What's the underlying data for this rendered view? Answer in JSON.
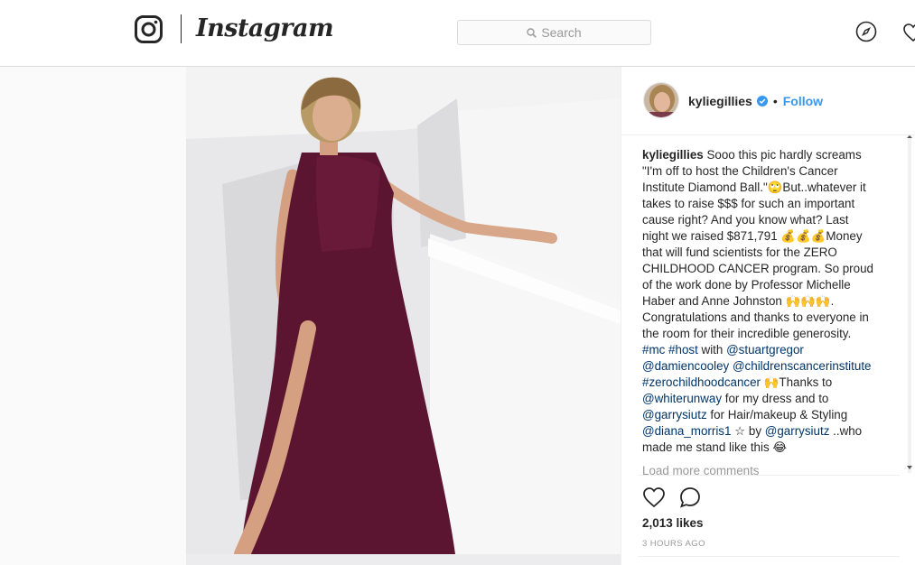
{
  "app": {
    "wordmark": "Instagram"
  },
  "search": {
    "placeholder": "Search"
  },
  "post": {
    "username": "kyliegillies",
    "verified": true,
    "follow_label": "Follow",
    "caption_lines": [
      "Sooo this pic hardly screams",
      "\"I'm off to host the Children's Cancer",
      "Institute Diamond Ball.\"🙄But..whatever it",
      "takes to raise $$$ for such an important",
      "cause right? And you know what? Last",
      "night we raised $871,791 💰💰💰Money",
      "that will fund scientists for the ZERO",
      "CHILDHOOD CANCER program. So proud",
      "of the work done by Professor Michelle",
      "Haber and Anne Johnston 🙌🙌🙌.",
      "Congratulations and thanks to everyone in",
      "the room for their incredible generosity."
    ],
    "line_13": {
      "tag1": "#mc",
      "tag2": "#host",
      "text": " with ",
      "mention": "@stuartgregor"
    },
    "line_14": {
      "mention1": "@damiencooley",
      "mention2": "@childrenscancerinstitute"
    },
    "line_15": {
      "tag": "#zerochildhoodcancer",
      "text": " 🙌Thanks to"
    },
    "line_16": {
      "mention": "@whiterunway",
      "text": " for my dress and to"
    },
    "line_17": {
      "mention": "@garrysiutz",
      "text": " for Hair/makeup & Styling"
    },
    "line_18": {
      "mention1": "@diana_morris1",
      "text1": " ☆ by ",
      "mention2": "@garrysiutz",
      "text2": " ..who"
    },
    "line_19": "made me stand like this 😂",
    "load_more": "Load more comments",
    "likes": "2,013 likes",
    "time": "3 HOURS AGO"
  },
  "colors": {
    "accent": "#3897f0",
    "link": "#003569",
    "dress": "#5c1530"
  },
  "icons": [
    "instagram-camera-icon",
    "search-icon",
    "compass-icon",
    "heart-icon",
    "verified-badge-icon",
    "like-icon",
    "comment-icon"
  ]
}
